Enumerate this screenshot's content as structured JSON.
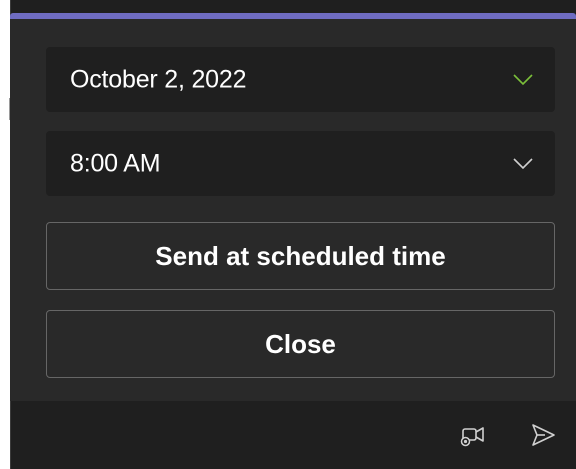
{
  "schedule": {
    "date_value": "October 2, 2022",
    "time_value": "8:00 AM",
    "send_label": "Send at scheduled time",
    "close_label": "Close"
  },
  "icons": {
    "date_chevron": "chevron-down-icon",
    "time_chevron": "chevron-down-icon",
    "meet_now": "video-meet-icon",
    "send": "send-icon"
  },
  "colors": {
    "accent": "#6f6cc2",
    "date_chevron": "#7bbf3a",
    "time_chevron": "#d0d0d0",
    "panel": "#292929",
    "field": "#1f1f1f"
  }
}
